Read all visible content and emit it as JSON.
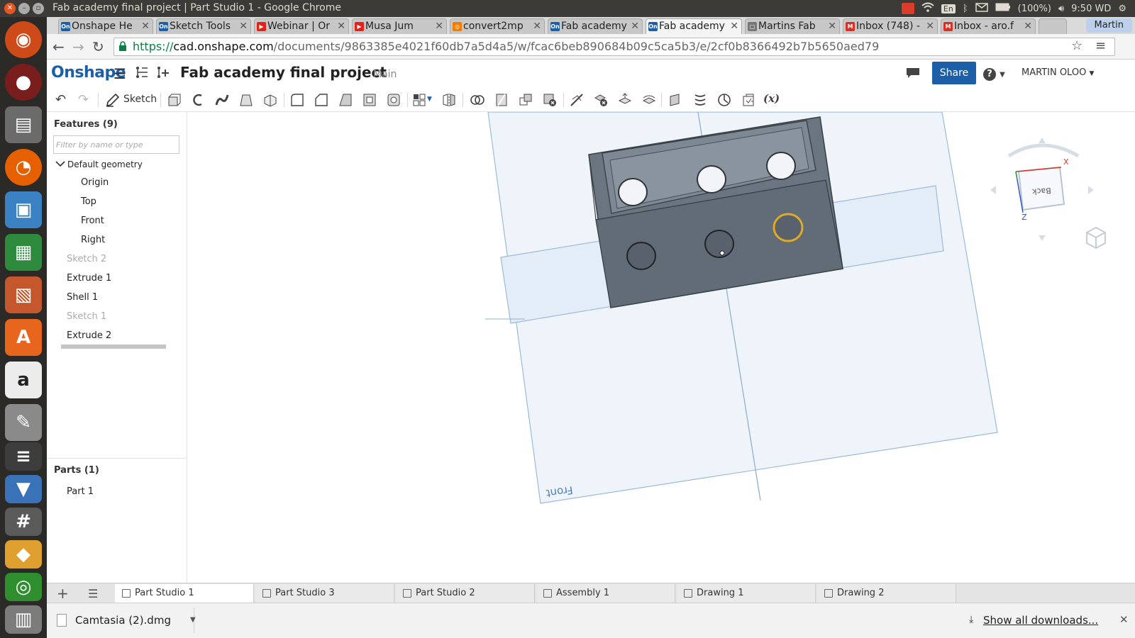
{
  "os": {
    "window_title": "Fab academy final project | Part Studio 1 - Google Chrome",
    "tray": {
      "lang": "En",
      "battery": "(100%)",
      "clock": "9:50 WD"
    }
  },
  "browser": {
    "tabs": [
      {
        "label": "Onshape He",
        "favicon": "On",
        "color": "#1c5ea8"
      },
      {
        "label": "Sketch Tools",
        "favicon": "On",
        "color": "#1c5ea8"
      },
      {
        "label": "Webinar | Or",
        "favicon": "▶",
        "color": "#e62117"
      },
      {
        "label": "Musa Jum",
        "favicon": "▶",
        "color": "#e62117"
      },
      {
        "label": "convert2mp",
        "favicon": "◎",
        "color": "#f57c00"
      },
      {
        "label": "Fab academy",
        "favicon": "On",
        "color": "#1c5ea8"
      },
      {
        "label": "Fab academy",
        "favicon": "On",
        "color": "#1c5ea8"
      },
      {
        "label": "Martins Fab",
        "favicon": "▢",
        "color": "#777777"
      },
      {
        "label": "Inbox (748) -",
        "favicon": "M",
        "color": "#d93025"
      },
      {
        "label": "Inbox - aro.f",
        "favicon": "M",
        "color": "#d93025"
      }
    ],
    "profile": "Martin",
    "url": {
      "protocol": "https://",
      "host": "cad.onshape.com",
      "path": "/documents/9863385e4021f60db7a5d4a5/w/fcac6beb890684b09c5ca5b3/e/2cf0b8366492b7b5650aed79"
    }
  },
  "onshape": {
    "brand": "Onshape",
    "document_title": "Fab academy final project",
    "branch": "Main",
    "share_label": "Share",
    "help_label": "?",
    "user": "MARTIN OLOO",
    "toolbar": {
      "sketch_label": "Sketch"
    },
    "features_header": "Features (9)",
    "filter_placeholder": "Filter by name or type",
    "features": [
      {
        "label": "Default geometry",
        "dim": false
      },
      {
        "label": "Origin",
        "dim": false
      },
      {
        "label": "Top",
        "dim": false
      },
      {
        "label": "Front",
        "dim": false
      },
      {
        "label": "Right",
        "dim": false
      },
      {
        "label": "Sketch 2",
        "dim": true
      },
      {
        "label": "Extrude 1",
        "dim": false
      },
      {
        "label": "Shell 1",
        "dim": false
      },
      {
        "label": "Sketch 1",
        "dim": true
      },
      {
        "label": "Extrude 2",
        "dim": false
      }
    ],
    "parts_header": "Parts (1)",
    "parts": [
      "Part 1"
    ],
    "viewport": {
      "front_plane_label": "Front",
      "viewcube_face": "Back",
      "axis_x": "X",
      "axis_z": "Z"
    },
    "bottom_tabs": [
      "Part Studio 1",
      "Part Studio 3",
      "Part Studio 2",
      "Assembly 1",
      "Drawing 1",
      "Drawing 2"
    ]
  },
  "downloads": {
    "file": "Camtasia (2).dmg",
    "show_all": "Show all downloads..."
  }
}
